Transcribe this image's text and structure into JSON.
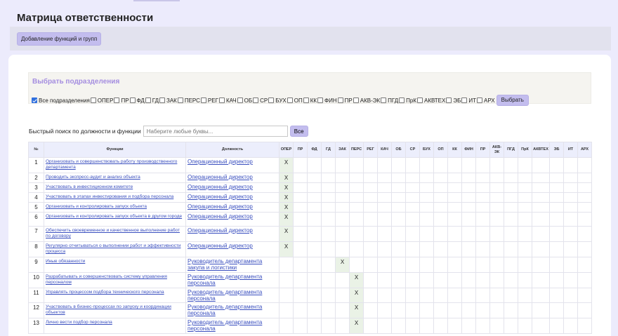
{
  "page_title": "Матрица ответственности",
  "toolbar": {
    "add_label": "Добавление функций и групп"
  },
  "filter": {
    "title": "Выбрать подразделения",
    "all_label": "Все подразделения",
    "departments": [
      "ОПЕР",
      "ПР",
      "ФД",
      "ГД",
      "ЗАК",
      "ПЕРС",
      "РЕГ",
      "КАЧ",
      "ОБ",
      "СР",
      "БУХ",
      "ОП",
      "КК",
      "ФИН",
      "ПР",
      "АКВ-ЭК",
      "ПГД",
      "ПрК",
      "АКВТЕХ",
      "ЭБ",
      "ИТ",
      "АРХ"
    ],
    "select_label": "Выбрать"
  },
  "search": {
    "label": "Быстрый поиск по должности и функции",
    "placeholder": "Наберите любые буквы...",
    "button_label": "Все"
  },
  "table": {
    "headers": {
      "num": "№",
      "func": "Функции",
      "pos": "Должность"
    },
    "departments": [
      "ОПЕР",
      "ПР",
      "ФД",
      "ГД",
      "ЗАК",
      "ПЕРС",
      "РЕГ",
      "КАЧ",
      "ОБ",
      "СР",
      "БУХ",
      "ОП",
      "КК",
      "ФИН",
      "ПР",
      "АКВ-ЭК",
      "ПГД",
      "ПрК",
      "АКВТЕХ",
      "ЭБ",
      "ИТ",
      "АРХ"
    ],
    "mark": "X",
    "rows": [
      {
        "num": "1",
        "func": "Организовать и совершенствовать работу производственного департамента",
        "pos": "Операционный директор",
        "dept": 0
      },
      {
        "num": "2",
        "func": "Проводить экспресс-аудит и анализ объекта",
        "pos": "Операционный директор",
        "dept": 0
      },
      {
        "num": "3",
        "func": "Участвовать в инвестиционном комитете",
        "pos": "Операционный директор",
        "dept": 0
      },
      {
        "num": "4",
        "func": "Участвовать в этапах инвестирования и подбора персонала",
        "pos": "Операционный директор",
        "dept": 0
      },
      {
        "num": "5",
        "func": "Организовать и контролировать запуск объекта",
        "pos": "Операционный директор",
        "dept": 0
      },
      {
        "num": "6",
        "func": "Организовать и контролировать запуск объекта в другом городе",
        "pos": "Операционный директор",
        "dept": 0
      },
      {
        "num": "7",
        "func": "Обеспечить своевременное и качественное выполнение работ по договору",
        "pos": "Операционный директор",
        "dept": 0
      },
      {
        "num": "8",
        "func": "Регулярно отчитываться о выполнении работ и эффективности процесса",
        "pos": "Операционный директор",
        "dept": 0
      },
      {
        "num": "9",
        "func": "Иные обязанности",
        "pos": "Руководитель департамента закупа и логистики",
        "dept": 4
      },
      {
        "num": "10",
        "func": "Разрабатывать и совершенствовать систему управления персоналом",
        "pos": "Руководитель департамента персонала",
        "dept": 5
      },
      {
        "num": "11",
        "func": "Управлять процессом подбора технического персонала",
        "pos": "Руководитель департамента персонала",
        "dept": 5
      },
      {
        "num": "12",
        "func": "Участвовать в бизнес-процессах по запуску и координации объектов",
        "pos": "Руководитель департамента персонала",
        "dept": 5
      },
      {
        "num": "13",
        "func": "Лично вести подбор персонала",
        "pos": "Руководитель департамента персонала",
        "dept": 5
      }
    ]
  }
}
